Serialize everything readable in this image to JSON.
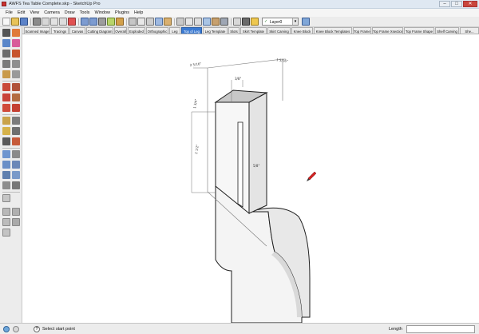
{
  "window": {
    "title": "AWFS Tea Table Complete.skp - SketchUp Pro",
    "minimize": "–",
    "maximize": "□",
    "close": "✕"
  },
  "menu": [
    "File",
    "Edit",
    "View",
    "Camera",
    "Draw",
    "Tools",
    "Window",
    "Plugins",
    "Help"
  ],
  "toolbar": {
    "layer": "Layer0",
    "layer_dropdown_arrow": "▾",
    "check": "✓"
  },
  "scenes": [
    "Scanned Image",
    "Tracings",
    "Canvas",
    "Cutting Diagram",
    "Overall",
    "Exploded",
    "Orthographic",
    "Leg",
    "Top of Leg",
    "Leg Template",
    "Slots",
    "Skirt Template",
    "Skirt Carving",
    "Knee Block",
    "Knee Block Templates",
    "Top Frame",
    "Top Frame Xsection",
    "Top Frame Shape",
    "Shelf Carving",
    "She..."
  ],
  "active_scene": "Top of Leg",
  "dimensions": {
    "top_left": "2 5/16\"",
    "top_right": "1 5/16\"",
    "top_small": "3/8\"",
    "side_left_upper": "1 3/4\"",
    "side_left_lower": "2 1/2\"",
    "inner": "5/8\""
  },
  "status": {
    "prompt": "Select start point",
    "measurement_label": "Length",
    "help": "?"
  },
  "colors": {
    "active_tab": "#3a79d1",
    "cursor": "#d22222",
    "model_face": "#f2f2f2",
    "model_top": "#c8c8c8"
  },
  "icons": {
    "title": "sketchup-logo-icon",
    "status_info": "info-icon",
    "status_geo": "geolocation-icon",
    "status_help": "help-icon",
    "cursor": "pencil-cursor-icon"
  }
}
